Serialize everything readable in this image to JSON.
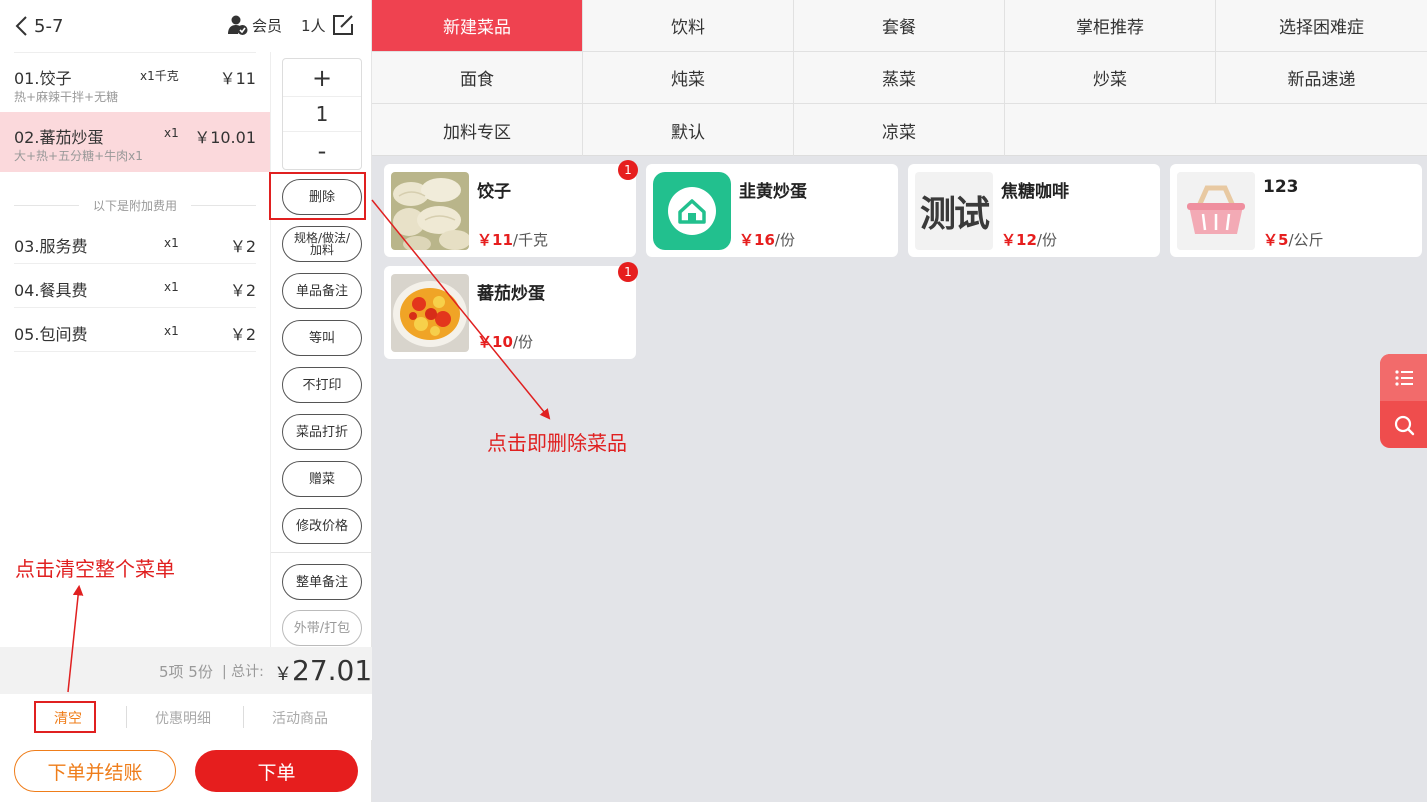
{
  "header": {
    "table_no": "5-7",
    "member_label": "会员",
    "people_label": "1人"
  },
  "orders": [
    {
      "name": "01.饺子",
      "qty": "x1千克",
      "price": "￥11",
      "spec": "热+麻辣干拌+无糖"
    },
    {
      "name": "02.蕃茄炒蛋",
      "qty": "x1",
      "price": "￥10.01",
      "spec": "大+热+五分糖+牛肉x1"
    }
  ],
  "extra_fees_label": "以下是附加费用",
  "fees": [
    {
      "name": "03.服务费",
      "qty": "x1",
      "price": "￥2"
    },
    {
      "name": "04.餐具费",
      "qty": "x1",
      "price": "￥2"
    },
    {
      "name": "05.包间费",
      "qty": "x1",
      "price": "￥2"
    }
  ],
  "stepper": {
    "plus": "+",
    "value": "1",
    "minus": "-"
  },
  "actions": {
    "delete": "删除",
    "spec": "规格/做法/加料",
    "note": "单品备注",
    "wait": "等叫",
    "no_print": "不打印",
    "discount": "菜品打折",
    "gift": "赠菜",
    "change_price": "修改价格",
    "order_note": "整单备注",
    "takeaway": "外带/打包"
  },
  "summary": {
    "count": "5项 5份",
    "total_label": "| 总计:",
    "currency": "￥",
    "total": "27.01"
  },
  "bottom_tabs": {
    "clear": "清空",
    "discount_detail": "优惠明细",
    "promo": "活动商品"
  },
  "buttons": {
    "order_and_pay": "下单并结账",
    "order": "下单"
  },
  "categories": [
    "新建菜品",
    "饮料",
    "套餐",
    "掌柜推荐",
    "选择困难症",
    "面食",
    "炖菜",
    "蒸菜",
    "炒菜",
    "新品速递",
    "加料专区",
    "默认",
    "凉菜"
  ],
  "active_category": "新建菜品",
  "dishes": [
    {
      "name": "饺子",
      "currency": "￥",
      "price": "11",
      "unit": "/千克",
      "badge": "1"
    },
    {
      "name": "韭黄炒蛋",
      "currency": "￥",
      "price": "16",
      "unit": "/份"
    },
    {
      "name": "焦糖咖啡",
      "currency": "￥",
      "price": "12",
      "unit": "/份",
      "thumb_text": "测试"
    },
    {
      "name": "123",
      "currency": "￥",
      "price": "5",
      "unit": "/公斤"
    },
    {
      "name": "蕃茄炒蛋",
      "currency": "￥",
      "price": "10",
      "unit": "/份",
      "badge": "1"
    }
  ],
  "annotations": {
    "delete_hint": "点击即删除菜品",
    "clear_hint": "点击清空整个菜单"
  },
  "colors": {
    "brand_red": "#e61e1e",
    "category_active": "#ef4250",
    "selected_row": "#fbd9dc",
    "orange": "#ef7d1a",
    "annotation": "#e02020"
  }
}
